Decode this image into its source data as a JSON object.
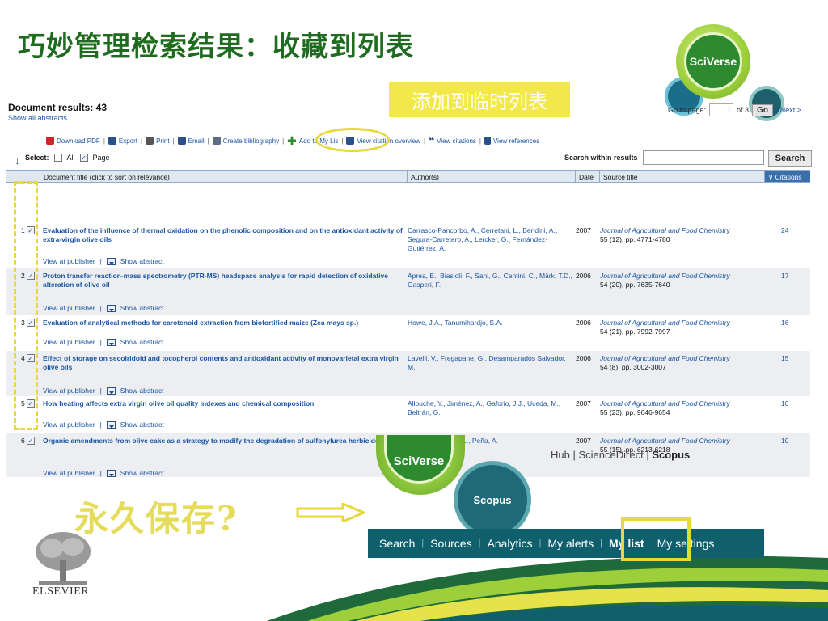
{
  "slide": {
    "title": "巧妙管理检索结果：收藏到列表",
    "callout_add": "添加到临时列表",
    "callout_permanent": "永久保存?"
  },
  "sciverse_badge": "SciVerse",
  "results": {
    "heading": "Document results: 43",
    "show_all": "Show all abstracts",
    "goto_label": "Go to page:",
    "goto_value": "1",
    "of_label": "of 3",
    "go_button": "Go",
    "next": "| Next >",
    "toolbar": {
      "download_pdf": "Download PDF",
      "export": "Export",
      "print": "Print",
      "email": "Email",
      "create_bib": "Create bibliography",
      "add_to_list": "Add to My Lis",
      "view_citation_overview": "View citation overview",
      "view_citations": "View citations",
      "view_references": "View references"
    },
    "select_label": "Select:",
    "select_all": "All",
    "select_page": "Page",
    "search_within": "Search within results",
    "search_button": "Search",
    "columns": {
      "title": "Document title (click to sort on relevance)",
      "authors": "Author(s)",
      "date": "Date",
      "source": "Source title",
      "citations": "Citations"
    },
    "view_at_publisher": "View at publisher",
    "show_abstract": "Show abstract",
    "rows": [
      {
        "num": "1",
        "title": "Evaluation of the influence of thermal oxidation on the phenolic composition and on the antioxidant activity of extra-virgin olive oils",
        "authors": "Carrasco-Pancorbo, A., Cerretani, L., Bendini, A., Segura-Carretero, A., Lercker, G., Fernández-Gutiérrez, A.",
        "date": "2007",
        "journal": "Journal of Agricultural and Food Chemistry",
        "volume": "55 (12), pp. 4771-4780",
        "citations": "24"
      },
      {
        "num": "2",
        "title": "Proton transfer reaction-mass spectrometry (PTR-MS) headspace analysis for rapid detection of oxidative alteration of olive oil",
        "authors": "Aprea, E., Biasioli, F., Sani, G., Cantini, C., Märk, T.D., Gasperi, F.",
        "date": "2006",
        "journal": "Journal of Agricultural and Food Chemistry",
        "volume": "54 (20), pp. 7635-7640",
        "citations": "17"
      },
      {
        "num": "3",
        "title": "Evaluation of analytical methods for carotenoid extraction from biofortified maize (Zea mays sp.)",
        "authors": "Howe, J.A., Tanumihardjo, S.A.",
        "date": "2006",
        "journal": "Journal of Agricultural and Food Chemistry",
        "volume": "54 (21), pp. 7992-7997",
        "citations": "16"
      },
      {
        "num": "4",
        "title": "Effect of storage on secoiridoid and tocopherol contents and antioxidant activity of monovarietal extra virgin olive oils",
        "authors": "Lavelli, V., Fregapane, G., Desamparados Salvador, M.",
        "date": "2006",
        "journal": "Journal of Agricultural and Food Chemistry",
        "volume": "54 (8), pp. 3002-3007",
        "citations": "15"
      },
      {
        "num": "5",
        "title": "How heating affects extra virgin olive oil quality indexes and chemical composition",
        "authors": "Allouche, Y., Jiménez, A., Gaforio, J.J., Uceda, M., Beltrán, G.",
        "date": "2007",
        "journal": "Journal of Agricultural and Food Chemistry",
        "volume": "55 (23), pp. 9646-9654",
        "citations": "10"
      },
      {
        "num": "6",
        "title": "Organic amendments from olive cake as a strategy to modify the degradation of sulfonylurea herbicides in soil",
        "authors": "Delgado-Moreno, L., Peña, A.",
        "date": "2007",
        "journal": "Journal of Agricultural and Food Chemistry",
        "volume": "55 (15), pp. 6213-6218",
        "citations": "10"
      }
    ]
  },
  "scopus": {
    "sciverse": "SciVerse",
    "scopus_label": "Scopus",
    "hub_links": [
      "Hub",
      "ScienceDirect",
      "Scopus"
    ],
    "nav": [
      "Search",
      "Sources",
      "Analytics",
      "My alerts",
      "My list",
      "My settings"
    ]
  },
  "elsevier": "ELSEVIER",
  "colors": {
    "title_green": "#1f6b1f",
    "highlight_yellow": "#e8d93a",
    "link_blue": "#1a55a3",
    "nav_teal": "#0f5f6c"
  }
}
